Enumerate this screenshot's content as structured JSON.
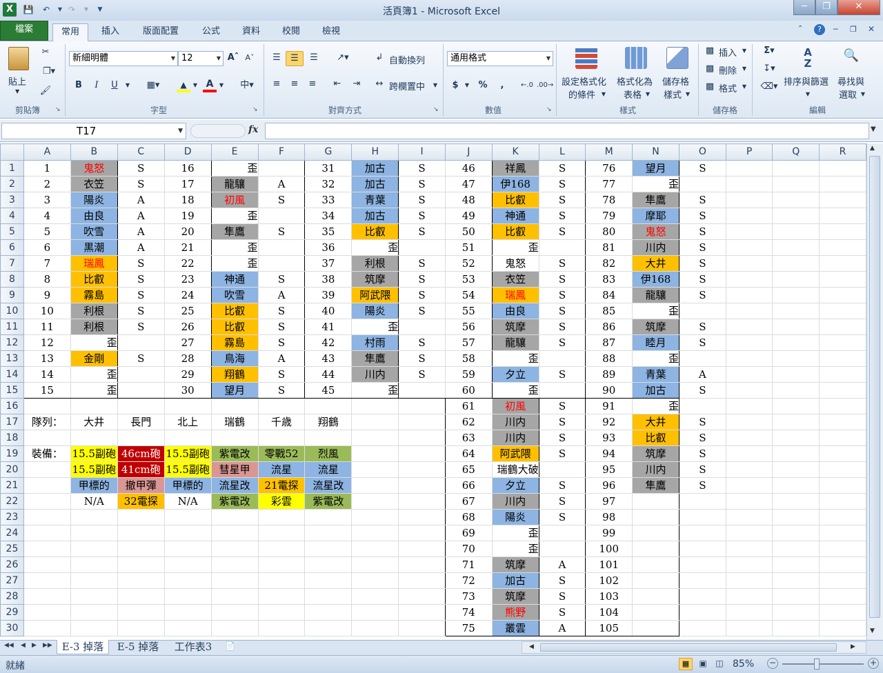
{
  "window": {
    "title": "活頁簿1  -  Microsoft Excel"
  },
  "tabs": {
    "file": "檔案",
    "items": [
      "常用",
      "插入",
      "版面配置",
      "公式",
      "資料",
      "校閱",
      "檢視"
    ]
  },
  "ribbon": {
    "clipboard": {
      "paste": "貼上",
      "group": "剪貼簿"
    },
    "font": {
      "name": "新細明體",
      "size": "12",
      "bold": "B",
      "italic": "I",
      "underline": "U",
      "group": "字型"
    },
    "alignment": {
      "wrap": "自動換列",
      "merge": "跨欄置中",
      "group": "對齊方式"
    },
    "number": {
      "format": "通用格式",
      "currency": "$",
      "percent": "%",
      "comma": ",",
      "group": "數值"
    },
    "styles": {
      "conditional": [
        "設定格式化",
        "的條件"
      ],
      "table": [
        "格式化為",
        "表格"
      ],
      "cell": [
        "儲存格",
        "樣式"
      ],
      "group": "樣式"
    },
    "cells": {
      "insert": "插入",
      "delete": "刪除",
      "format": "格式",
      "group": "儲存格"
    },
    "editing": {
      "sort": [
        "排序與篩選"
      ],
      "find": [
        "尋找與",
        "選取"
      ],
      "group": "編輯"
    }
  },
  "formula_bar": {
    "name_box": "T17",
    "fx": "fx",
    "formula": ""
  },
  "grid": {
    "columns": [
      "A",
      "B",
      "C",
      "D",
      "E",
      "F",
      "G",
      "H",
      "I",
      "J",
      "K",
      "L",
      "M",
      "N",
      "O",
      "P",
      "Q",
      "R"
    ],
    "rows": [
      [
        "1",
        "鬼怒",
        "S",
        "16",
        "歪",
        "",
        "31",
        "加古",
        "S",
        "46",
        "祥鳳",
        "S",
        "76",
        "望月",
        "S"
      ],
      [
        "2",
        "衣笠",
        "S",
        "17",
        "龍驤",
        "A",
        "32",
        "加古",
        "S",
        "47",
        "伊168",
        "S",
        "77",
        "歪",
        ""
      ],
      [
        "3",
        "陽炎",
        "A",
        "18",
        "初風",
        "S",
        "33",
        "青葉",
        "S",
        "48",
        "比叡",
        "S",
        "78",
        "隼鷹",
        "S"
      ],
      [
        "4",
        "由良",
        "A",
        "19",
        "歪",
        "",
        "34",
        "加古",
        "S",
        "49",
        "神通",
        "S",
        "79",
        "摩耶",
        "S"
      ],
      [
        "5",
        "吹雪",
        "A",
        "20",
        "隼鷹",
        "S",
        "35",
        "比叡",
        "S",
        "50",
        "比叡",
        "S",
        "80",
        "鬼怒",
        "S"
      ],
      [
        "6",
        "黒潮",
        "A",
        "21",
        "歪",
        "",
        "36",
        "歪",
        "",
        "51",
        "歪",
        "",
        "81",
        "川内",
        "S"
      ],
      [
        "7",
        "瑞鳳",
        "S",
        "22",
        "歪",
        "",
        "37",
        "利根",
        "S",
        "52",
        "鬼怒",
        "S",
        "82",
        "大井",
        "S"
      ],
      [
        "8",
        "比叡",
        "S",
        "23",
        "神通",
        "S",
        "38",
        "筑摩",
        "S",
        "53",
        "衣笠",
        "S",
        "83",
        "伊168",
        "S"
      ],
      [
        "9",
        "霧島",
        "S",
        "24",
        "吹雪",
        "A",
        "39",
        "阿武隈",
        "S",
        "54",
        "瑞鳳",
        "S",
        "84",
        "龍驤",
        "S"
      ],
      [
        "10",
        "利根",
        "S",
        "25",
        "比叡",
        "S",
        "40",
        "陽炎",
        "S",
        "55",
        "由良",
        "S",
        "85",
        "歪",
        ""
      ],
      [
        "11",
        "利根",
        "S",
        "26",
        "比叡",
        "S",
        "41",
        "歪",
        "",
        "56",
        "筑摩",
        "S",
        "86",
        "筑摩",
        "S"
      ],
      [
        "12",
        "歪",
        "",
        "27",
        "霧島",
        "S",
        "42",
        "村雨",
        "S",
        "57",
        "龍驤",
        "S",
        "87",
        "睦月",
        "S"
      ],
      [
        "13",
        "金剛",
        "S",
        "28",
        "鳥海",
        "A",
        "43",
        "隼鷹",
        "S",
        "58",
        "歪",
        "",
        "88",
        "歪",
        ""
      ],
      [
        "14",
        "歪",
        "",
        "29",
        "翔鶴",
        "S",
        "44",
        "川内",
        "S",
        "59",
        "夕立",
        "S",
        "89",
        "青葉",
        "A"
      ],
      [
        "15",
        "歪",
        "",
        "30",
        "望月",
        "S",
        "45",
        "歪",
        "",
        "60",
        "歪",
        "",
        "90",
        "加古",
        "S"
      ],
      [
        "",
        "",
        "",
        "",
        "",
        "",
        "",
        "",
        "",
        "61",
        "初風",
        "S",
        "91",
        "歪",
        ""
      ],
      [
        "隊列：",
        "大井",
        "長門",
        "北上",
        "瑞鶴",
        "千歳",
        "翔鶴",
        "",
        "",
        "62",
        "川内",
        "S",
        "92",
        "大井",
        "S"
      ],
      [
        "",
        "",
        "",
        "",
        "",
        "",
        "",
        "",
        "",
        "63",
        "川内",
        "S",
        "93",
        "比叡",
        "S"
      ],
      [
        "裝備：",
        "15.5副砲",
        "46cm砲",
        "15.5副砲",
        "紫電改",
        "零戰52",
        "烈風",
        "",
        "",
        "64",
        "阿武隈",
        "S",
        "94",
        "筑摩",
        "S"
      ],
      [
        "",
        "15.5副砲",
        "41cm砲",
        "15.5副砲",
        "彗星甲",
        "流星",
        "流星",
        "",
        "",
        "65",
        "瑞鶴大破",
        "",
        "95",
        "川内",
        "S"
      ],
      [
        "",
        "甲標的",
        "撤甲彈",
        "甲標的",
        "流星改",
        "21電探",
        "流星改",
        "",
        "",
        "66",
        "夕立",
        "S",
        "96",
        "隼鷹",
        "S"
      ],
      [
        "",
        "N/A",
        "32電探",
        "N/A",
        "紫電改",
        "彩雲",
        "紫電改",
        "",
        "",
        "67",
        "川内",
        "S",
        "97",
        "",
        ""
      ],
      [
        "",
        "",
        "",
        "",
        "",
        "",
        "",
        "",
        "",
        "68",
        "陽炎",
        "S",
        "98",
        "",
        ""
      ],
      [
        "",
        "",
        "",
        "",
        "",
        "",
        "",
        "",
        "",
        "69",
        "歪",
        "",
        "99",
        "",
        ""
      ],
      [
        "",
        "",
        "",
        "",
        "",
        "",
        "",
        "",
        "",
        "70",
        "歪",
        "",
        "100",
        "",
        ""
      ],
      [
        "",
        "",
        "",
        "",
        "",
        "",
        "",
        "",
        "",
        "71",
        "筑摩",
        "A",
        "101",
        "",
        ""
      ],
      [
        "",
        "",
        "",
        "",
        "",
        "",
        "",
        "",
        "",
        "72",
        "加古",
        "S",
        "102",
        "",
        ""
      ],
      [
        "",
        "",
        "",
        "",
        "",
        "",
        "",
        "",
        "",
        "73",
        "筑摩",
        "S",
        "103",
        "",
        ""
      ],
      [
        "",
        "",
        "",
        "",
        "",
        "",
        "",
        "",
        "",
        "74",
        "熊野",
        "S",
        "104",
        "",
        ""
      ],
      [
        "",
        "",
        "",
        "",
        "",
        "",
        "",
        "",
        "",
        "75",
        "叢雲",
        "A",
        "105",
        "",
        ""
      ]
    ]
  },
  "sheets": [
    "E-3 掉落",
    "E-5 掉落",
    "工作表3"
  ],
  "status": {
    "ready": "就緒",
    "zoom": "85%"
  },
  "colors": {
    "gray": "#a6a6a6",
    "blue": "#8db4e2",
    "orange": "#ffc000",
    "yellow": "#ffff00",
    "red": "#c00000",
    "green": "#9bbb59",
    "pink": "#da9694",
    "red_text": "#ff0000"
  }
}
